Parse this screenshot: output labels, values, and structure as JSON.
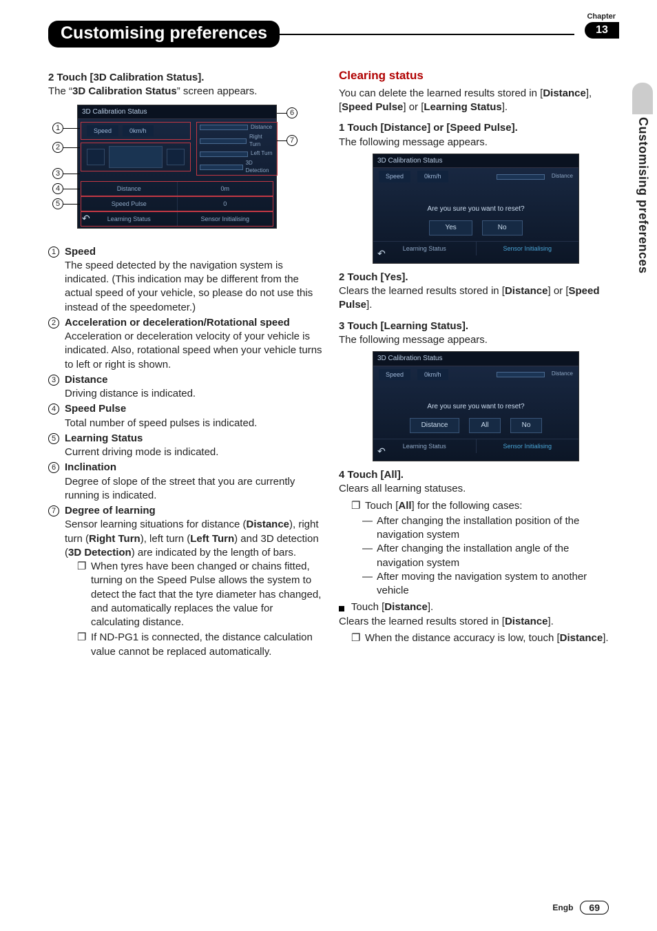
{
  "chapter_label": "Chapter",
  "chapter_num": "13",
  "page_title": "Customising preferences",
  "side_tab_text": "Customising preferences",
  "footer": {
    "lang": "Engb",
    "page": "69"
  },
  "left": {
    "step2_head": "2    Touch [3D Calibration Status].",
    "step2_line": "The “",
    "step2_bold": "3D Calibration Status",
    "step2_tail": "” screen appears.",
    "diagram": {
      "screen_title": "3D Calibration Status",
      "speed_label": "Speed",
      "speed_value": "0km/h",
      "prog": [
        {
          "label": "Distance"
        },
        {
          "label": "Right Turn"
        },
        {
          "label": "Left Turn"
        },
        {
          "label": "3D Detection"
        }
      ],
      "rows": [
        {
          "l": "Distance",
          "r": "0m"
        },
        {
          "l": "Speed Pulse",
          "r": "0"
        },
        {
          "l": "Learning Status",
          "r": "Sensor Initialising"
        }
      ],
      "callouts": [
        "1",
        "2",
        "3",
        "4",
        "5",
        "6",
        "7"
      ]
    },
    "annotations": [
      {
        "n": "1",
        "head": "Speed",
        "body": "The speed detected by the navigation system is indicated. (This indication may be different from the actual speed of your vehicle, so please do not use this instead of the speedometer.)"
      },
      {
        "n": "2",
        "head": "Acceleration or deceleration/Rotational speed",
        "body": "Acceleration or deceleration velocity of your vehicle is indicated. Also, rotational speed when your vehicle turns to left or right is shown."
      },
      {
        "n": "3",
        "head": "Distance",
        "body": "Driving distance is indicated."
      },
      {
        "n": "4",
        "head": "Speed Pulse",
        "body": "Total number of speed pulses is indicated."
      },
      {
        "n": "5",
        "head": "Learning Status",
        "body": "Current driving mode is indicated."
      },
      {
        "n": "6",
        "head": "Inclination",
        "body": "Degree of slope of the street that you are currently running is indicated."
      },
      {
        "n": "7",
        "head": "Degree of learning",
        "body_intro": "Sensor learning situations for distance (",
        "b1": "Distance",
        "m1": "), right turn (",
        "b2": "Right Turn",
        "m2": "), left turn (",
        "b3": "Left Turn",
        "m3": ") and 3D detection (",
        "b4": "3D Detection",
        "m4": ") are indicated by the length of bars.",
        "bullets": [
          "When tyres have been changed or chains fitted, turning on the Speed Pulse allows the system to detect the fact that the tyre diameter has changed, and automatically replaces the value for calculating distance.",
          "If ND-PG1 is connected, the distance calculation value cannot be replaced automatically."
        ]
      }
    ]
  },
  "right": {
    "h_clearing": "Clearing status",
    "clearing_intro_1": "You can delete the learned results stored in [",
    "b_distance": "Distance",
    "sep1": "], [",
    "b_speed": "Speed Pulse",
    "sep2": "] or [",
    "b_learn": "Learning Status",
    "end1": "].",
    "step1_head": "1    Touch [Distance] or [Speed Pulse].",
    "following_msg": "The following message appears.",
    "dlg1": {
      "title": "3D Calibration Status",
      "speed_label": "Speed",
      "speed_value": "0km/h",
      "prog_label": "Distance",
      "msg": "Are you sure you want to reset?",
      "btns": [
        "Yes",
        "No"
      ],
      "bottom_l": "Learning Status",
      "bottom_r": "Sensor Initialising"
    },
    "step2_head": "2    Touch [Yes].",
    "step2_body_a": "Clears the learned results stored in [",
    "step2_body_b": "] or [",
    "step2_body_c": "].",
    "step3_head": "3    Touch [Learning Status].",
    "dlg2": {
      "title": "3D Calibration Status",
      "speed_label": "Speed",
      "speed_value": "0km/h",
      "prog_label": "Distance",
      "msg": "Are you sure you want to reset?",
      "btns": [
        "Distance",
        "All",
        "No"
      ],
      "bottom_l": "Learning Status",
      "bottom_r": "Sensor Initialising"
    },
    "step4_head": "4    Touch [All].",
    "step4_line": "Clears all learning statuses.",
    "step4_bullet_lead": "Touch [",
    "step4_bullet_b": "All",
    "step4_bullet_tail": "] for the following cases:",
    "step4_dashes": [
      "After changing the installation position of the navigation system",
      "After changing the installation angle of the navigation system",
      "After moving the navigation system to another vehicle"
    ],
    "touch_distance_lead": "Touch [",
    "touch_distance_b": "Distance",
    "touch_distance_tail": "].",
    "touch_distance_line_a": "Clears the learned results stored in [",
    "touch_distance_line_b": "].",
    "touch_distance_bullet_a": "When the distance accuracy is low, touch [",
    "touch_distance_bullet_b": "Distance",
    "touch_distance_bullet_c": "]."
  }
}
